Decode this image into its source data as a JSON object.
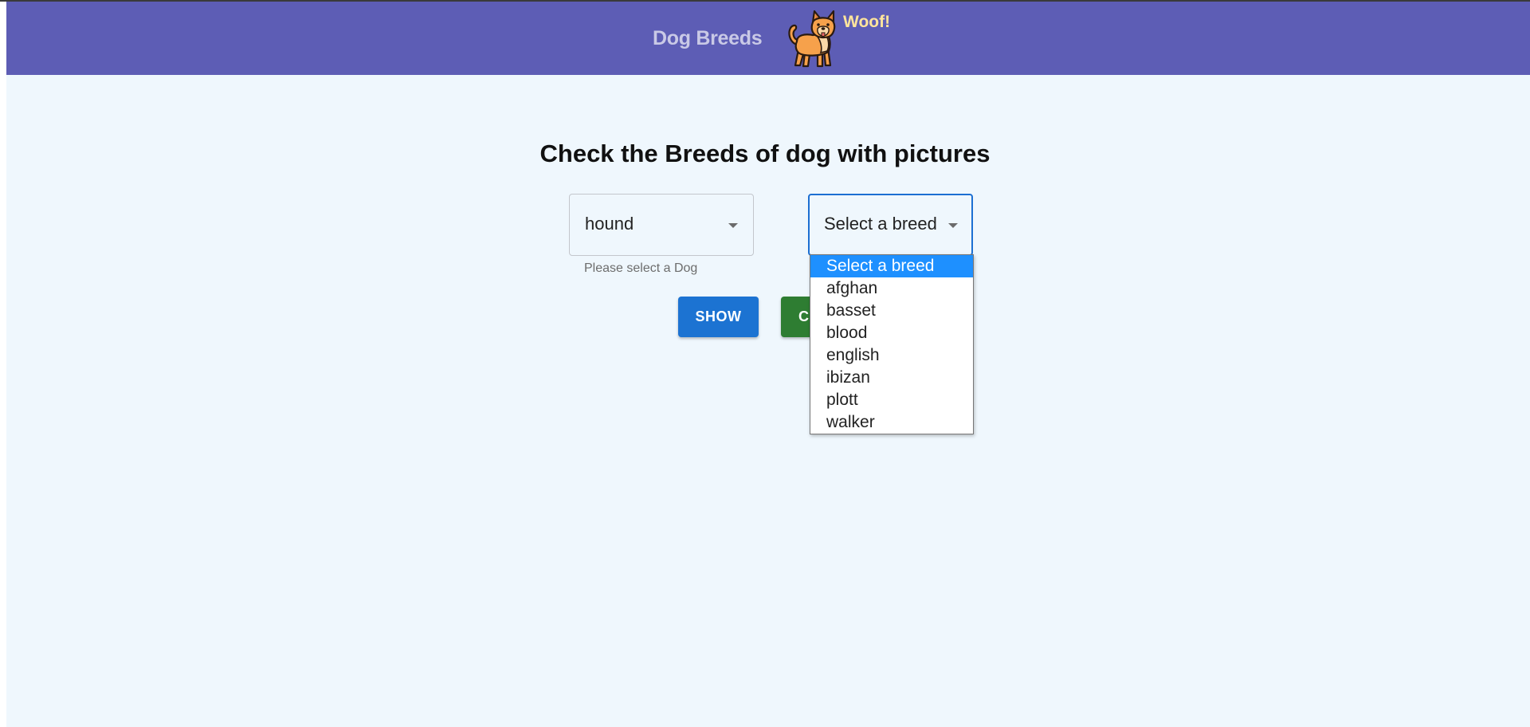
{
  "header": {
    "brand": "Dog Breeds",
    "logo_icon": "dog-icon",
    "woof": "Woof!",
    "background": "#5d5db5"
  },
  "main": {
    "title": "Check the Breeds of dog with pictures",
    "dog_select": {
      "value": "hound",
      "helper": "Please select a Dog"
    },
    "breed_select": {
      "value": "Select a breed",
      "options": [
        "Select a breed",
        "afghan",
        "basset",
        "blood",
        "english",
        "ibizan",
        "plott",
        "walker"
      ],
      "highlighted_index": 0
    },
    "buttons": {
      "show": "SHOW",
      "clear": "C"
    }
  },
  "colors": {
    "page_background": "#eff7fd",
    "show_button": "#1c73d2",
    "clear_button": "#2e7d32",
    "option_highlight": "#1e90ff"
  }
}
